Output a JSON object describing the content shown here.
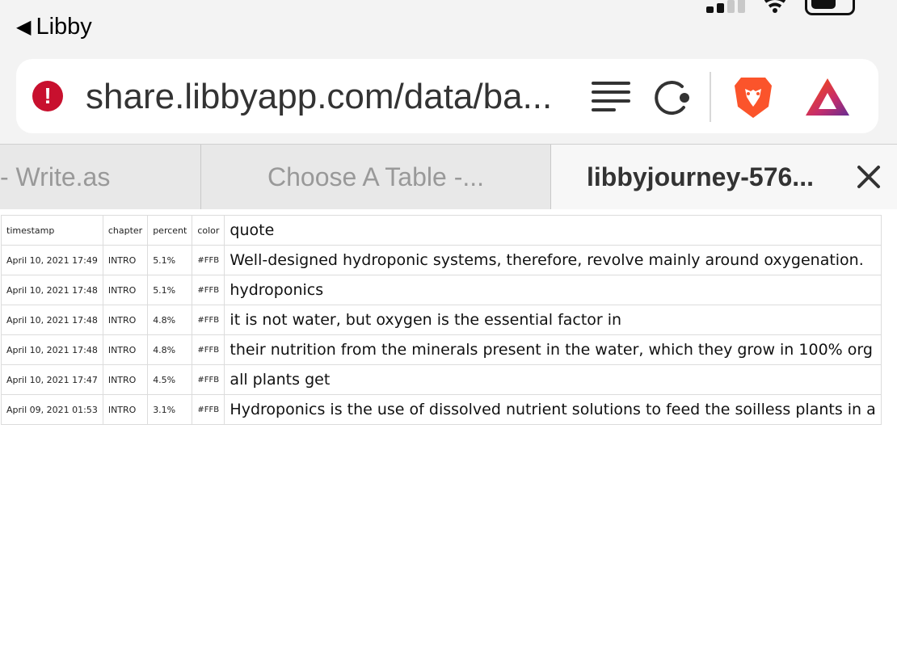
{
  "status_bar": {
    "back_label": "Libby"
  },
  "address_bar": {
    "url": "share.libbyapp.com/data/ba..."
  },
  "tabs": [
    {
      "label": "- Write.as"
    },
    {
      "label": "Choose A Table -..."
    },
    {
      "label": "libbyjourney-576..."
    }
  ],
  "table": {
    "headers": [
      "timestamp",
      "chapter",
      "percent",
      "color",
      "quote"
    ],
    "rows": [
      [
        "April 10, 2021 17:49",
        "INTRO",
        "5.1%",
        "#FFB",
        "Well-designed hydroponic systems, therefore, revolve mainly around oxygenation."
      ],
      [
        "April 10, 2021 17:48",
        "INTRO",
        "5.1%",
        "#FFB",
        "hydroponics"
      ],
      [
        "April 10, 2021 17:48",
        "INTRO",
        "4.8%",
        "#FFB",
        "it is not water, but oxygen is the essential factor in"
      ],
      [
        "April 10, 2021 17:48",
        "INTRO",
        "4.8%",
        "#FFB",
        "their nutrition from the minerals present in the water, which they grow in 100% org"
      ],
      [
        "April 10, 2021 17:47",
        "INTRO",
        "4.5%",
        "#FFB",
        "all plants get"
      ],
      [
        "April 09, 2021 01:53",
        "INTRO",
        "3.1%",
        "#FFB",
        "Hydroponics is the use of dissolved nutrient solutions to feed the soilless plants in a"
      ]
    ]
  },
  "colors": {
    "warning": "#c8102e",
    "brave_orange": "#fb542b",
    "chrome_bg": "#f3f3f3",
    "tabbar_bg": "#e8e8e8"
  }
}
